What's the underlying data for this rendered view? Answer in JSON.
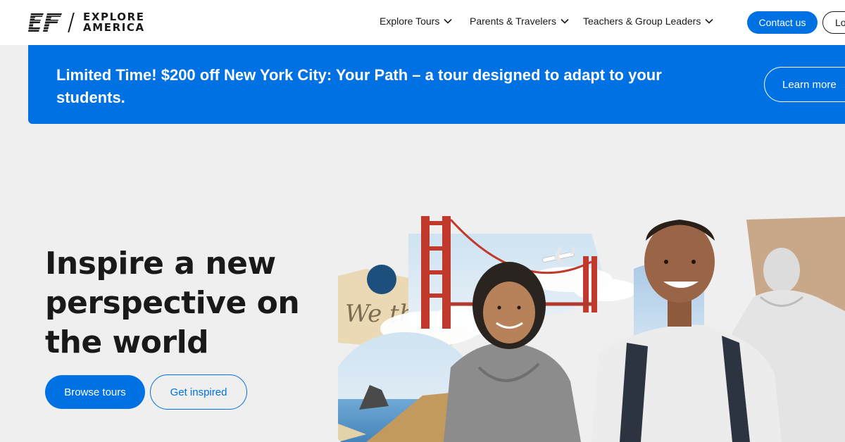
{
  "header": {
    "brand": {
      "line1": "EXPLORE",
      "line2": "AMERICA",
      "mark_icon": "ef-logo-icon"
    },
    "nav": [
      {
        "label": "Explore Tours",
        "icon": "chevron-down-icon"
      },
      {
        "label": "Parents & Travelers",
        "icon": "chevron-down-icon"
      },
      {
        "label": "Teachers & Group Leaders",
        "icon": "chevron-down-icon"
      }
    ],
    "contact_label": "Contact us",
    "login_label": "Lo"
  },
  "promo": {
    "text": "Limited Time! $200 off New York City: Your Path – a tour designed to adapt to your students.",
    "button_label": "Learn more"
  },
  "hero": {
    "title": "Inspire a new perspective on the world",
    "primary_button": "Browse tours",
    "secondary_button": "Get inspired",
    "collage": {
      "description_icons": [
        "golden-gate-bridge-icon",
        "airplane-icon",
        "lincoln-statue-icon",
        "washington-monument-icon",
        "student-girl-icon",
        "student-boy-icon",
        "constitution-text-icon"
      ],
      "parchment_text": "We the"
    }
  },
  "colors": {
    "brand_blue": "#0071e3",
    "page_background": "#efefef",
    "text_dark": "#191919",
    "white": "#ffffff"
  }
}
